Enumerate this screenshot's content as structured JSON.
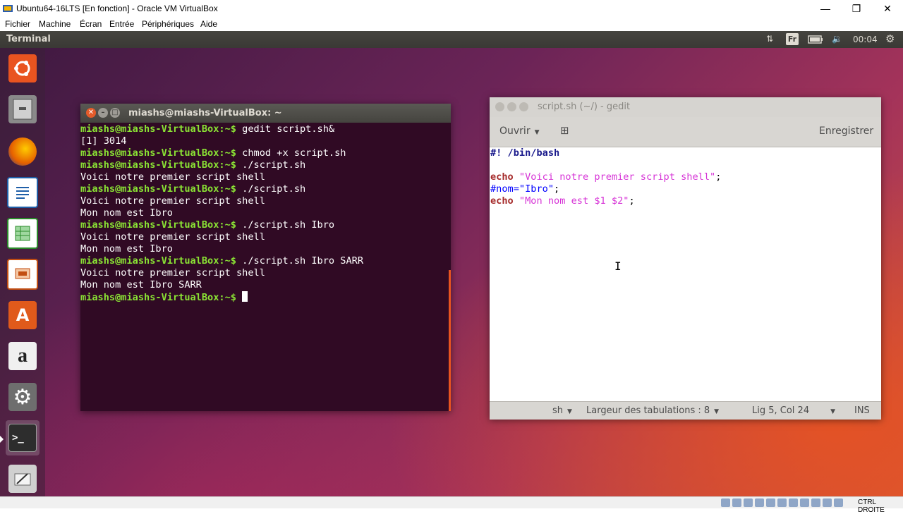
{
  "vbox": {
    "title": "Ubuntu64-16LTS [En fonction] - Oracle VM VirtualBox",
    "menu": [
      "Fichier",
      "Machine",
      "Écran",
      "Entrée",
      "Périphériques",
      "Aide"
    ],
    "statusbar": {
      "host_key": "CTRL DROITE"
    }
  },
  "ubuntu": {
    "topbar": {
      "app_title": "Terminal",
      "keyboard_layout": "Fr",
      "time": "00:04"
    },
    "launcher": [
      {
        "name": "ubuntu-dash",
        "icon": "ubuntu-logo-icon",
        "color": "#e95420"
      },
      {
        "name": "files",
        "icon": "file-cabinet-icon",
        "color": "#8a8a8a"
      },
      {
        "name": "firefox",
        "icon": "firefox-icon",
        "color": "#e66000"
      },
      {
        "name": "writer",
        "icon": "document-icon",
        "color": "#1f5fa8"
      },
      {
        "name": "calc",
        "icon": "spreadsheet-icon",
        "color": "#2a8a2a"
      },
      {
        "name": "impress",
        "icon": "presentation-icon",
        "color": "#c24e12"
      },
      {
        "name": "software",
        "icon": "shopping-bag-icon",
        "color": "#e05a1b"
      },
      {
        "name": "amazon",
        "icon": "amazon-icon",
        "color": "#e8e8e8"
      },
      {
        "name": "settings",
        "icon": "settings-gear-icon",
        "color": "#777777"
      },
      {
        "name": "terminal",
        "icon": "terminal-icon",
        "color": "#2d2d2d"
      },
      {
        "name": "text-editor",
        "icon": "text-editor-icon",
        "color": "#cccccc"
      }
    ]
  },
  "terminal": {
    "title": "miashs@miashs-VirtualBox: ~",
    "lines": [
      {
        "prompt": "miashs@miashs-VirtualBox:~$ ",
        "text": "gedit script.sh&"
      },
      {
        "prompt": "",
        "text": "[1] 3014"
      },
      {
        "prompt": "miashs@miashs-VirtualBox:~$ ",
        "text": "chmod +x script.sh"
      },
      {
        "prompt": "miashs@miashs-VirtualBox:~$ ",
        "text": "./script.sh"
      },
      {
        "prompt": "",
        "text": "Voici notre premier script shell"
      },
      {
        "prompt": "miashs@miashs-VirtualBox:~$ ",
        "text": "./script.sh"
      },
      {
        "prompt": "",
        "text": "Voici notre premier script shell"
      },
      {
        "prompt": "",
        "text": "Mon nom est Ibro"
      },
      {
        "prompt": "miashs@miashs-VirtualBox:~$ ",
        "text": "./script.sh Ibro"
      },
      {
        "prompt": "",
        "text": "Voici notre premier script shell"
      },
      {
        "prompt": "",
        "text": "Mon nom est Ibro"
      },
      {
        "prompt": "miashs@miashs-VirtualBox:~$ ",
        "text": "./script.sh Ibro SARR"
      },
      {
        "prompt": "",
        "text": "Voici notre premier script shell"
      },
      {
        "prompt": "",
        "text": "Mon nom est Ibro SARR"
      },
      {
        "prompt": "miashs@miashs-VirtualBox:~$ ",
        "text": ""
      }
    ]
  },
  "gedit": {
    "title": "script.sh (~/) - gedit",
    "open_label": "Ouvrir",
    "save_label": "Enregistrer",
    "code": [
      [
        {
          "cls": "kw-shebang",
          "t": "#! /bin/bash"
        }
      ],
      [],
      [
        {
          "cls": "kw",
          "t": "echo"
        },
        {
          "cls": "str",
          "t": " \"Voici notre premier script shell\""
        },
        {
          "cls": "",
          "t": ";"
        }
      ],
      [
        {
          "cls": "comment",
          "t": "#nom=\"Ibro\""
        },
        {
          "cls": "",
          "t": ";"
        }
      ],
      [
        {
          "cls": "kw",
          "t": "echo"
        },
        {
          "cls": "str",
          "t": " \"Mon nom est $1 $2\""
        },
        {
          "cls": "",
          "t": ";"
        }
      ]
    ],
    "status": {
      "language": "sh",
      "tab_width": "Largeur des tabulations : 8",
      "position": "Lig 5, Col 24",
      "mode": "INS"
    }
  }
}
